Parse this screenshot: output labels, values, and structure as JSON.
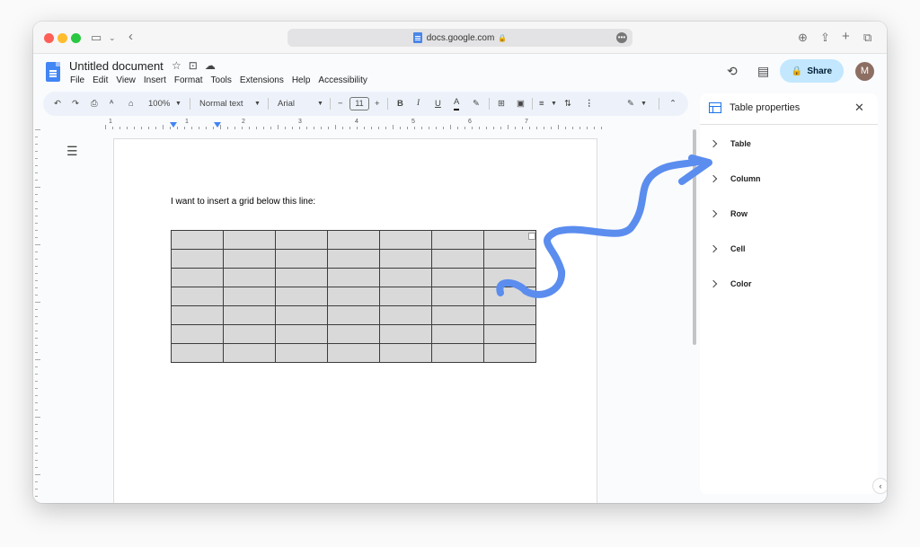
{
  "browser": {
    "url": "docs.google.com"
  },
  "doc": {
    "title": "Untitled document",
    "menu": [
      "File",
      "Edit",
      "View",
      "Insert",
      "Format",
      "Tools",
      "Extensions",
      "Help",
      "Accessibility"
    ],
    "share_label": "Share",
    "avatar_letter": "M"
  },
  "toolbar": {
    "zoom": "100%",
    "style": "Normal text",
    "font": "Arial",
    "font_size": "11",
    "minus": "−",
    "plus": "+",
    "bold": "B",
    "italic": "I",
    "underline": "U",
    "text_color": "A"
  },
  "ruler": {
    "numbers": [
      "1",
      "1",
      "2",
      "3",
      "4",
      "5",
      "6",
      "7"
    ]
  },
  "page": {
    "body_text": "I want to insert a grid below this line:",
    "table": {
      "rows": 7,
      "cols": 7
    }
  },
  "side_panel": {
    "title": "Table properties",
    "items": [
      "Table",
      "Column",
      "Row",
      "Cell",
      "Color"
    ]
  },
  "colors": {
    "share_bg": "#c2e7ff",
    "accent": "#4a86e8",
    "arrow": "#5b8def",
    "cell_fill": "#d9d9d9"
  }
}
